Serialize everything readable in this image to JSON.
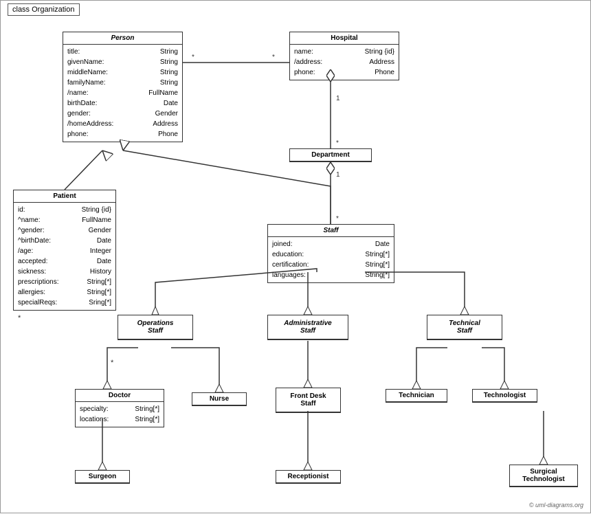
{
  "diagram": {
    "title": "class Organization",
    "copyright": "© uml-diagrams.org",
    "classes": {
      "person": {
        "name": "Person",
        "italic": true,
        "attrs": [
          {
            "name": "title:",
            "type": "String"
          },
          {
            "name": "givenName:",
            "type": "String"
          },
          {
            "name": "middleName:",
            "type": "String"
          },
          {
            "name": "familyName:",
            "type": "String"
          },
          {
            "name": "/name:",
            "type": "FullName"
          },
          {
            "name": "birthDate:",
            "type": "Date"
          },
          {
            "name": "gender:",
            "type": "Gender"
          },
          {
            "name": "/homeAddress:",
            "type": "Address"
          },
          {
            "name": "phone:",
            "type": "Phone"
          }
        ]
      },
      "hospital": {
        "name": "Hospital",
        "italic": false,
        "attrs": [
          {
            "name": "name:",
            "type": "String {id}"
          },
          {
            "name": "/address:",
            "type": "Address"
          },
          {
            "name": "phone:",
            "type": "Phone"
          }
        ]
      },
      "department": {
        "name": "Department",
        "italic": false,
        "attrs": []
      },
      "staff": {
        "name": "Staff",
        "italic": true,
        "attrs": [
          {
            "name": "joined:",
            "type": "Date"
          },
          {
            "name": "education:",
            "type": "String[*]"
          },
          {
            "name": "certification:",
            "type": "String[*]"
          },
          {
            "name": "languages:",
            "type": "String[*]"
          }
        ]
      },
      "patient": {
        "name": "Patient",
        "italic": false,
        "attrs": [
          {
            "name": "id:",
            "type": "String {id}"
          },
          {
            "name": "^name:",
            "type": "FullName"
          },
          {
            "name": "^gender:",
            "type": "Gender"
          },
          {
            "name": "^birthDate:",
            "type": "Date"
          },
          {
            "name": "/age:",
            "type": "Integer"
          },
          {
            "name": "accepted:",
            "type": "Date"
          },
          {
            "name": "sickness:",
            "type": "History"
          },
          {
            "name": "prescriptions:",
            "type": "String[*]"
          },
          {
            "name": "allergies:",
            "type": "String[*]"
          },
          {
            "name": "specialReqs:",
            "type": "Sring[*]"
          }
        ]
      },
      "operations_staff": {
        "name": "Operations Staff",
        "italic": true
      },
      "administrative_staff": {
        "name": "Administrative Staff",
        "italic": true
      },
      "technical_staff": {
        "name": "Technical Staff",
        "italic": true
      },
      "doctor": {
        "name": "Doctor",
        "italic": false,
        "attrs": [
          {
            "name": "specialty:",
            "type": "String[*]"
          },
          {
            "name": "locations:",
            "type": "String[*]"
          }
        ]
      },
      "nurse": {
        "name": "Nurse",
        "italic": false,
        "attrs": []
      },
      "front_desk_staff": {
        "name": "Front Desk Staff",
        "italic": false,
        "attrs": []
      },
      "technician": {
        "name": "Technician",
        "italic": false,
        "attrs": []
      },
      "technologist": {
        "name": "Technologist",
        "italic": false,
        "attrs": []
      },
      "surgeon": {
        "name": "Surgeon",
        "italic": false,
        "attrs": []
      },
      "receptionist": {
        "name": "Receptionist",
        "italic": false,
        "attrs": []
      },
      "surgical_technologist": {
        "name": "Surgical Technologist",
        "italic": false,
        "attrs": []
      }
    }
  }
}
